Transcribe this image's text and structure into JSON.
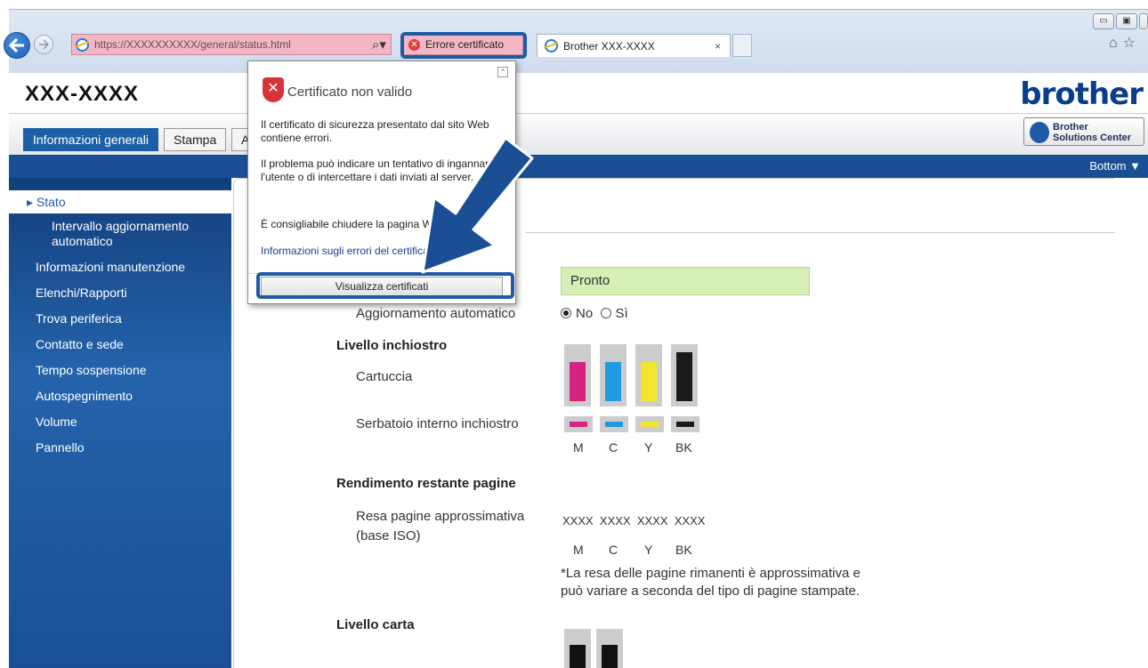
{
  "browser": {
    "address": "https://XXXXXXXXXX/general/status.html",
    "cert_error_label": "Errore certificato",
    "tab_title": "Brother XXX-XXXX",
    "tab_close": "×"
  },
  "header": {
    "model": "XXX-XXXX",
    "brand": "brother",
    "solutions_line1": "Brother",
    "solutions_line2": "Solutions Center"
  },
  "tabs": [
    "Informazioni generali",
    "Stampa",
    "A"
  ],
  "bar": {
    "bottom": "Bottom ▼"
  },
  "sidebar": {
    "selected": "Stato",
    "sub": "Intervallo aggiornamento automatico",
    "items": [
      "Informazioni manutenzione",
      "Elenchi/Rapporti",
      "Trova periferica",
      "Contatto e sede",
      "Tempo sospensione",
      "Autospegnimento",
      "Volume",
      "Pannello"
    ]
  },
  "popup": {
    "title": "Certificato non valido",
    "p1": "Il certificato di sicurezza presentato dal sito Web contiene errori.",
    "p2": "Il problema può indicare un tentativo di ingannare l'utente o di intercettare i dati inviati al server.",
    "p3": "È consigliabile chiudere la pagina Web.",
    "link": "Informazioni sugli errori del certificato",
    "button": "Visualizza certificati"
  },
  "status": {
    "value": "Pronto",
    "auto_update_label": "Aggiornamento automatico",
    "opt_no": "No",
    "opt_si": "Sì",
    "selected": "No"
  },
  "ink": {
    "heading": "Livello inchiostro",
    "cartridge": "Cartuccia",
    "tank": "Serbatoio interno inchiostro",
    "letters": [
      "M",
      "C",
      "Y",
      "BK"
    ],
    "colors": [
      "#d6237e",
      "#1e9be0",
      "#f2e52e",
      "#1a1a1a"
    ],
    "cartridge_levels": [
      0.75,
      0.75,
      0.75,
      0.95
    ],
    "tank_levels": [
      1,
      1,
      1,
      1
    ]
  },
  "yield": {
    "heading": "Rendimento restante pagine",
    "label_line1": "Resa pagine approssimativa",
    "label_line2": "(base ISO)",
    "values": "XXXX  XXXX  XXXX  XXXX",
    "letters": [
      "M",
      "C",
      "Y",
      "BK"
    ],
    "note_line1": "*La resa delle pagine rimanenti è approssimativa e",
    "note_line2": "può variare a seconda del tipo di pagine stampate."
  },
  "paper": {
    "heading": "Livello carta"
  }
}
